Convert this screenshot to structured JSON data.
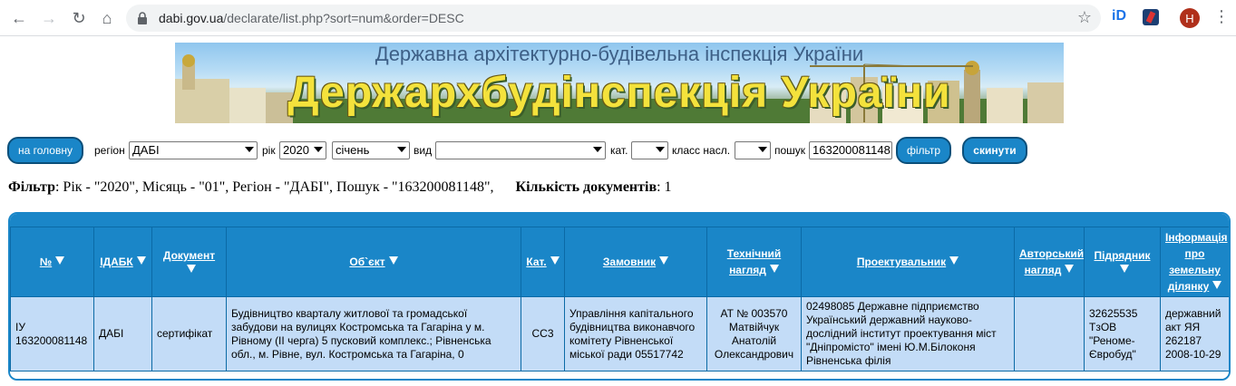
{
  "browser": {
    "url_host": "dabi.gov.ua",
    "url_path": "/declarate/list.php?sort=num&order=DESC",
    "profile_initial": "H",
    "ext_label": "iD"
  },
  "banner": {
    "subtitle": "Державна архітектурно-будівельна інспекція України",
    "title": "Держархбудінспекція України"
  },
  "filter_bar": {
    "home_button": "на головну",
    "region_label": "регіон",
    "region_value": "ДАБІ",
    "year_label": "рік",
    "year_value": "2020",
    "month_value": "січень",
    "kind_label": "вид",
    "kind_value": "",
    "cat_label": "кат.",
    "cat_value": "",
    "class_label": "класс насл.",
    "class_value": "",
    "search_label": "пошук",
    "search_value": "163200081148",
    "filter_button": "фільтр",
    "reset_button": "скинути"
  },
  "summary": {
    "filter_label": "Фільтр",
    "filter_text": ": Рік - \"2020\", Місяць - \"01\", Регіон - \"ДАБІ\", Пошук - \"163200081148\",",
    "count_label": "Кількість документів",
    "count_value": ": 1"
  },
  "table": {
    "headers": {
      "num": "№",
      "idabk": "ІДАБК",
      "doc": "Документ",
      "object": "Об`єкт",
      "cat": "Кат.",
      "customer": "Замовник",
      "tech1": "Технічний",
      "tech2": "нагляд",
      "designer": "Проектувальник",
      "auth1": "Авторський",
      "auth2": "нагляд",
      "contractor": "Підрядник",
      "land1": "Інформація",
      "land2": "про",
      "land3": "земельну",
      "land4": "ділянку"
    },
    "row": {
      "num": "ІУ 163200081148",
      "idabk": "ДАБІ",
      "doc": "сертифікат",
      "object": "Будівництво кварталу житлової та громадської забудови на вулицях Костромська та Гагаріна у м. Рівному (ІІ черга) 5 пусковий комплекс.; Рівненська обл., м. Рівне, вул. Костромська та Гагаріна, 0",
      "cat": "СС3",
      "customer": "Управління капітального будівництва виконавчого комітету Рівненської міської ради 05517742",
      "tech": "АТ № 003570 Матвійчук Анатолій Олександрович",
      "designer": "02498085 Державне підприємство Український державний науково-дослідний інститут проектування міст \"Дніпромісто\" імені Ю.М.Білоконя Рівненська філія",
      "auth": "",
      "contractor": "32625535 ТзОВ \"Реноме-Євробуд\"",
      "land": "державний акт ЯЯ 262187 2008-10-29"
    }
  }
}
